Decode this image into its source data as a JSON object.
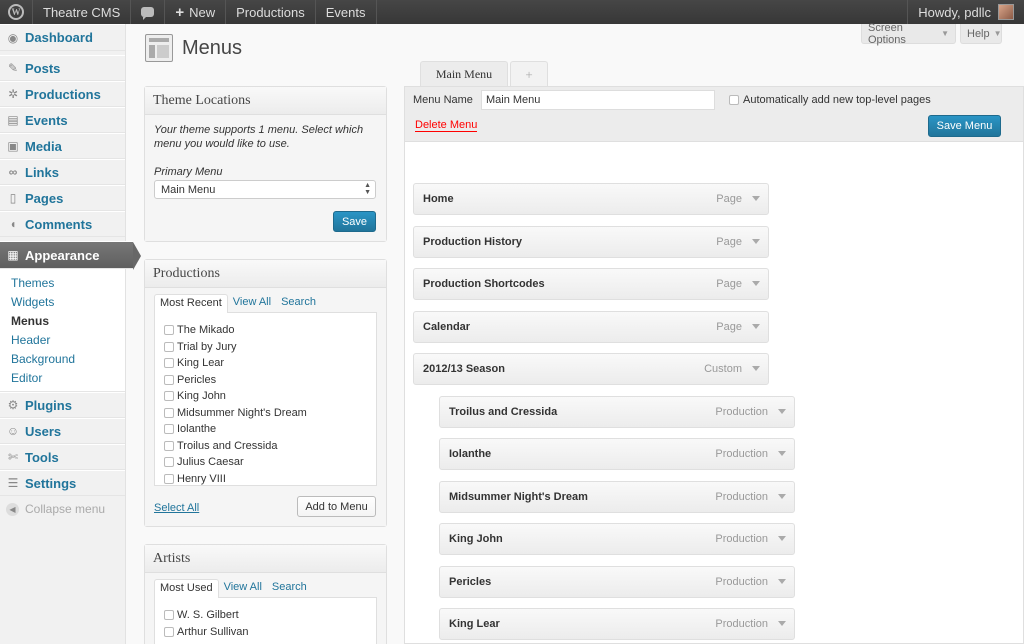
{
  "admin_bar": {
    "site_name": "Theatre CMS",
    "new_label": "New",
    "links": [
      "Productions",
      "Events"
    ],
    "greeting": "Howdy, pdllc"
  },
  "sidebar": {
    "items": [
      {
        "label": "Dashboard",
        "icon": "dashboard-icon"
      },
      {
        "label": "Posts",
        "icon": "pin-icon"
      },
      {
        "label": "Productions",
        "icon": "gear-icon"
      },
      {
        "label": "Events",
        "icon": "calendar-icon"
      },
      {
        "label": "Media",
        "icon": "media-icon"
      },
      {
        "label": "Links",
        "icon": "link-icon"
      },
      {
        "label": "Pages",
        "icon": "page-icon"
      },
      {
        "label": "Comments",
        "icon": "comment-icon"
      },
      {
        "label": "Appearance",
        "icon": "appearance-icon"
      }
    ],
    "submenu": [
      "Themes",
      "Widgets",
      "Menus",
      "Header",
      "Background",
      "Editor"
    ],
    "items_after": [
      {
        "label": "Plugins",
        "icon": "plugin-icon"
      },
      {
        "label": "Users",
        "icon": "users-icon"
      },
      {
        "label": "Tools",
        "icon": "tools-icon"
      },
      {
        "label": "Settings",
        "icon": "settings-icon"
      }
    ],
    "collapse_label": "Collapse menu"
  },
  "page": {
    "title": "Menus",
    "screen_options": "Screen Options",
    "help": "Help"
  },
  "theme_locations": {
    "title": "Theme Locations",
    "description": "Your theme supports 1 menu. Select which menu you would like to use.",
    "primary_label": "Primary Menu",
    "selected": "Main Menu",
    "save_label": "Save"
  },
  "productions_box": {
    "title": "Productions",
    "tabs": [
      "Most Recent",
      "View All",
      "Search"
    ],
    "items": [
      "The Mikado",
      "Trial by Jury",
      "King Lear",
      "Pericles",
      "King John",
      "Midsummer Night's Dream",
      "Iolanthe",
      "Troilus and Cressida",
      "Julius Caesar",
      "Henry VIII"
    ],
    "select_all": "Select All",
    "add_label": "Add to Menu"
  },
  "artists_box": {
    "title": "Artists",
    "tabs": [
      "Most Used",
      "View All",
      "Search"
    ],
    "items": [
      "W. S. Gilbert",
      "Arthur Sullivan"
    ]
  },
  "menu_editor": {
    "tab_active": "Main Menu",
    "tab_add": "+",
    "name_label": "Menu Name",
    "name_value": "Main Menu",
    "auto_add_label": "Automatically add new top-level pages",
    "delete_label": "Delete Menu",
    "save_label": "Save Menu",
    "items": [
      {
        "title": "Home",
        "type": "Page",
        "depth": 0
      },
      {
        "title": "Production History",
        "type": "Page",
        "depth": 0
      },
      {
        "title": "Production Shortcodes",
        "type": "Page",
        "depth": 0
      },
      {
        "title": "Calendar",
        "type": "Page",
        "depth": 0
      },
      {
        "title": "2012/13 Season",
        "type": "Custom",
        "depth": 0
      },
      {
        "title": "Troilus and Cressida",
        "type": "Production",
        "depth": 1
      },
      {
        "title": "Iolanthe",
        "type": "Production",
        "depth": 1
      },
      {
        "title": "Midsummer Night's Dream",
        "type": "Production",
        "depth": 1
      },
      {
        "title": "King John",
        "type": "Production",
        "depth": 1
      },
      {
        "title": "Pericles",
        "type": "Production",
        "depth": 1
      },
      {
        "title": "King Lear",
        "type": "Production",
        "depth": 1
      }
    ]
  },
  "colors": {
    "link": "#21759b",
    "primary_button": "#21759b",
    "delete": "#ff0000",
    "admin_bar": "#464646"
  }
}
